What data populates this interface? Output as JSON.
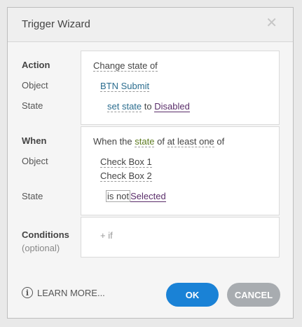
{
  "dialog": {
    "title": "Trigger Wizard",
    "close_glyph": "✕"
  },
  "action": {
    "heading": "Action",
    "object_label": "Object",
    "state_label": "State",
    "verb": "Change state of",
    "object_value": "BTN Submit",
    "state_prefix": "set state",
    "state_to": "to",
    "state_value": "Disabled"
  },
  "when": {
    "heading": "When",
    "object_label": "Object",
    "state_label": "State",
    "phrase_start": "When the",
    "phrase_state": "state",
    "phrase_of": "of",
    "phrase_quantifier": "at least one",
    "phrase_end": "of",
    "objects": [
      "Check Box 1",
      "Check Box 2"
    ],
    "operator": "is not",
    "state_value": "Selected"
  },
  "conditions": {
    "heading": "Conditions",
    "subheading": "(optional)",
    "add_if": "+ if"
  },
  "footer": {
    "info_glyph": "i",
    "learn_more": "LEARN MORE...",
    "ok": "OK",
    "cancel": "CANCEL"
  },
  "colors": {
    "ok_button": "#1a82d6",
    "cancel_button": "#a8acb0",
    "link": "#2b6d8f",
    "state_value": "#5a2d6a"
  },
  "icons": {
    "close": "close-icon",
    "info": "info-icon"
  }
}
